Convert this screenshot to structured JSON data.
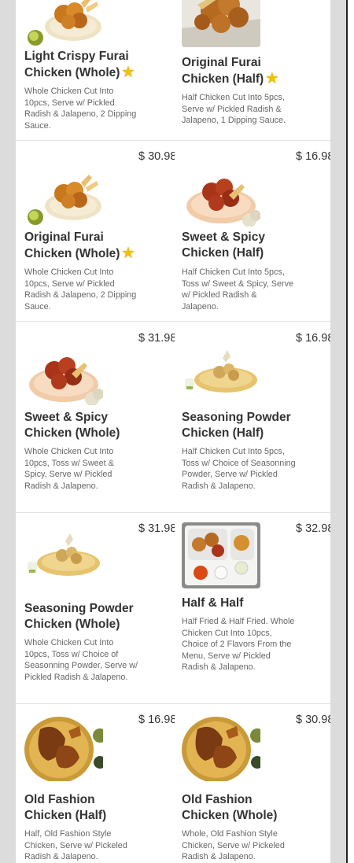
{
  "menu": {
    "rows": [
      {
        "items": [
          {
            "name": "Light Crispy Furai Chicken (Whole)",
            "starred": true,
            "star_icon": "star-icon",
            "description": "Whole Chicken Cut Into 10pcs, Serve w/ Pickled Radish & Jalapeno, 2 Dipping Sauce.",
            "price": "",
            "image": "fried-chicken-plate"
          },
          {
            "name": "Original Furai Chicken (Half)",
            "starred": true,
            "star_icon": "star-icon",
            "description": "Half Chicken Cut Into 5pcs, Serve w/ Pickled Radish & Jalapeno, 1 Dipping Sauce.",
            "price": "",
            "image": "fried-chicken-box"
          }
        ]
      },
      {
        "items": [
          {
            "name": "Original Furai Chicken (Whole)",
            "starred": true,
            "star_icon": "star-icon",
            "description": "Whole Chicken Cut Into 10pcs, Serve w/ Pickled Radish & Jalapeno, 2 Dipping Sauce.",
            "price": "$ 30.98",
            "image": "fried-chicken-plate"
          },
          {
            "name": "Sweet & Spicy Chicken (Half)",
            "starred": false,
            "description": "Half Chicken Cut Into 5pcs, Toss w/ Sweet & Spicy, Serve w/ Pickled Radish & Jalapeno.",
            "price": "$ 16.98",
            "image": "spicy-chicken-plate"
          }
        ]
      },
      {
        "items": [
          {
            "name": "Sweet & Spicy Chicken (Whole)",
            "starred": false,
            "description": "Whole Chicken Cut Into 10pcs, Toss w/ Sweet & Spicy, Serve w/ Pickled Radish & Jalapeno.",
            "price": "$ 31.98",
            "image": "spicy-chicken-plate"
          },
          {
            "name": "Seasoning Powder Chicken (Half)",
            "starred": false,
            "description": "Half Chicken Cut Into 5pcs, Toss w/ Choice of Seasonning Powder, Serve w/ Pickled Radish & Jalapeno.",
            "price": "$ 16.98",
            "image": "powder-chicken-plate"
          }
        ]
      },
      {
        "items": [
          {
            "name": "Seasoning Powder Chicken (Whole)",
            "starred": false,
            "description": "Whole Chicken Cut Into 10pcs, Toss w/ Choice of Seasonning Powder, Serve w/ Pickled Radish & Jalapeno.",
            "price": "$ 31.98",
            "image": "powder-chicken-plate"
          },
          {
            "name": "Half & Half",
            "starred": false,
            "description": "Half Fried & Half Fried. Whole Chicken Cut Into 10pcs, Choice of 2 Flavors From the Menu, Serve w/ Pickled Radish & Jalapeno.",
            "price": "$ 32.98",
            "image": "half-half-platter"
          }
        ]
      },
      {
        "items": [
          {
            "name": "Old Fashion Chicken (Half)",
            "starred": false,
            "description": "Half, Old Fashion Style Chicken, Serve w/ Pickeled Radish & Jalapeno.",
            "price": "$ 16.98",
            "image": "old-fashion-chicken-plate"
          },
          {
            "name": "Old Fashion Chicken (Whole)",
            "starred": false,
            "description": "Whole, Old Fashion Style Chicken, Serve w/ Pickeled Radish & Jalapeno.",
            "price": "$ 30.98",
            "image": "old-fashion-chicken-plate"
          }
        ]
      }
    ]
  }
}
